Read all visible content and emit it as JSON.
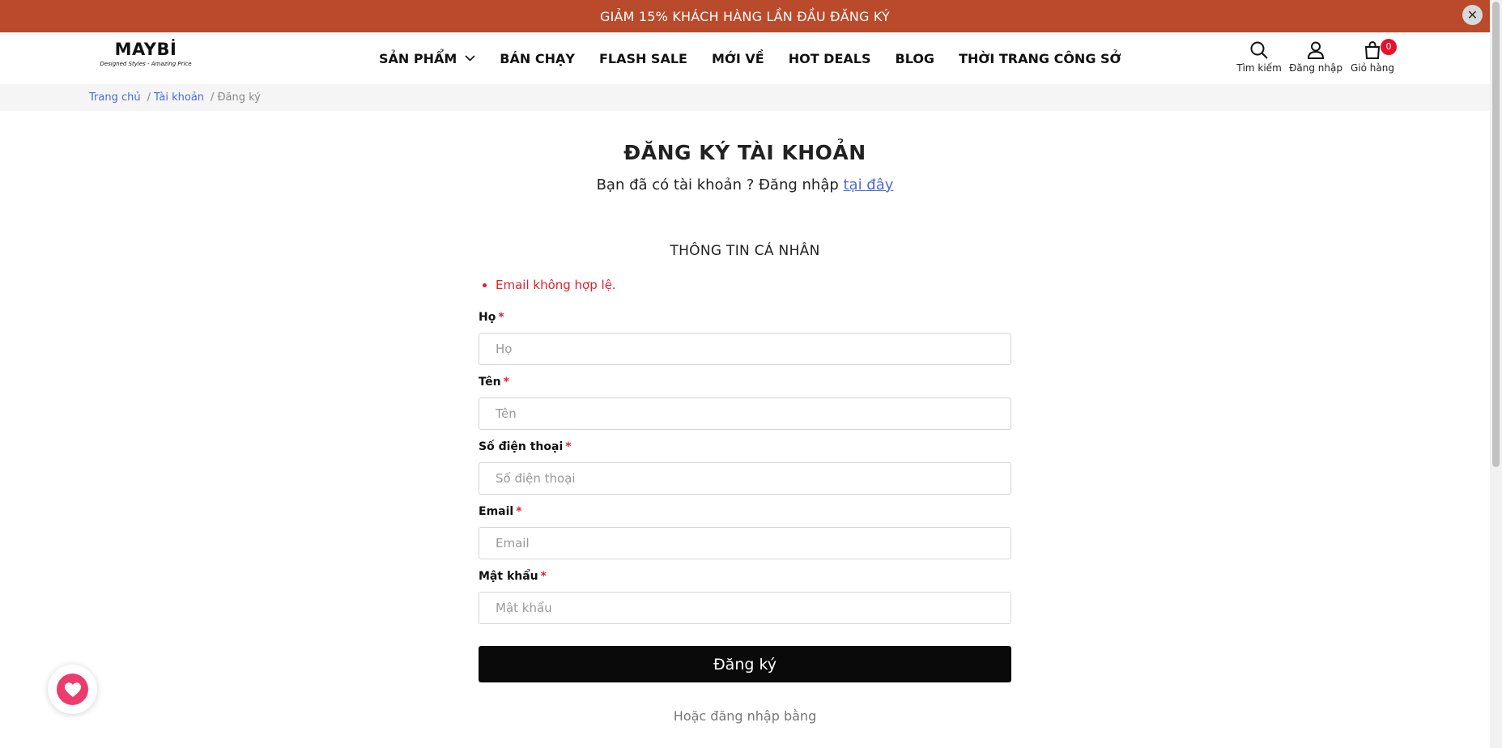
{
  "promo": {
    "text": "GIẢM 15% KHÁCH HÀNG LẦN ĐẦU ĐĂNG KÝ",
    "close_icon": "✕"
  },
  "brand": {
    "name": "MAYBİ",
    "tagline": "Designed Styles - Amazing Price"
  },
  "nav": {
    "items": [
      "SẢN PHẨM",
      "BÁN CHẠY",
      "FLASH SALE",
      "MỚI VỀ",
      "HOT DEALS",
      "BLOG",
      "THỜI TRANG CÔNG SỞ"
    ]
  },
  "header_actions": {
    "search_label": "Tìm kiếm",
    "login_label": "Đăng nhập",
    "cart_label": "Giỏ hàng",
    "cart_count": "0"
  },
  "breadcrumb": {
    "home": "Trang chủ",
    "account": "Tài khoản",
    "current": "Đăng ký",
    "separator": "/"
  },
  "page": {
    "title": "ĐĂNG KÝ TÀI KHOẢN",
    "login_prompt": "Bạn đã có tài khoản ? Đăng nhập ",
    "login_link": "tại đây",
    "section_title": "THÔNG TIN CÁ NHÂN",
    "error": "Email không hợp lệ."
  },
  "form": {
    "required_mark": "*",
    "last_name": {
      "label": "Họ",
      "placeholder": "Họ"
    },
    "first_name": {
      "label": "Tên",
      "placeholder": "Tên"
    },
    "phone": {
      "label": "Số điện thoại",
      "placeholder": "Số điện thoại"
    },
    "email": {
      "label": "Email",
      "placeholder": "Email"
    },
    "password": {
      "label": "Mật khẩu",
      "placeholder": "Mật khẩu"
    },
    "submit_label": "Đăng ký",
    "alt_login": "Hoặc đăng nhập bằng"
  },
  "colors": {
    "promo_bg": "#b94a2c",
    "accent_link": "#4a6ad9",
    "error": "#e0202f",
    "button_bg": "#0a0a0a",
    "badge": "#e8102b",
    "wishlist": "#ec3c6e"
  },
  "icons": [
    "close-icon",
    "chevron-down-icon",
    "search-icon",
    "user-icon",
    "cart-icon",
    "heart-icon"
  ]
}
